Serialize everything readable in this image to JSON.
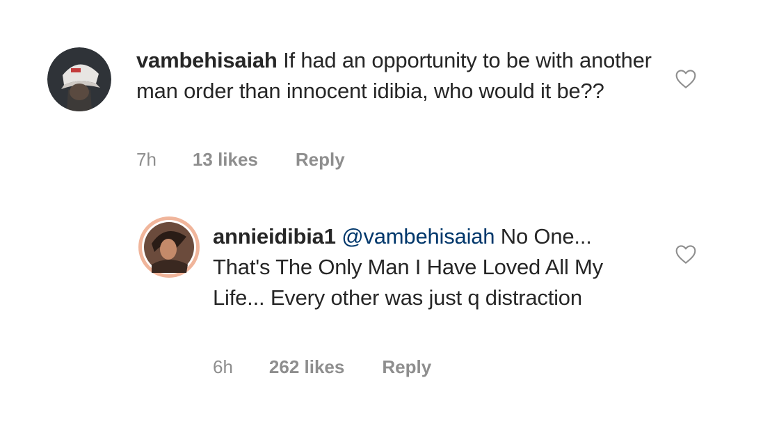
{
  "comments": [
    {
      "username": "vambehisaiah",
      "text": "If had an opportunity  to be with another man order than innocent idibia, who would it be??",
      "time": "7h",
      "likes": "13 likes",
      "reply_label": "Reply",
      "avatar_icon": "user-avatar-cap",
      "like_icon": "heart-outline-icon"
    },
    {
      "username": "annieidibia1",
      "mention": "@vambehisaiah",
      "text": "No One... That's The Only Man I Have Loved All My Life... Every other was just q distraction",
      "time": "6h",
      "likes": "262 likes",
      "reply_label": "Reply",
      "avatar_icon": "user-avatar-story-ring",
      "like_icon": "heart-outline-icon"
    }
  ],
  "colors": {
    "text": "#262626",
    "meta": "#8e8e8e",
    "mention": "#00376b",
    "story_ring": "#f0b59b"
  }
}
